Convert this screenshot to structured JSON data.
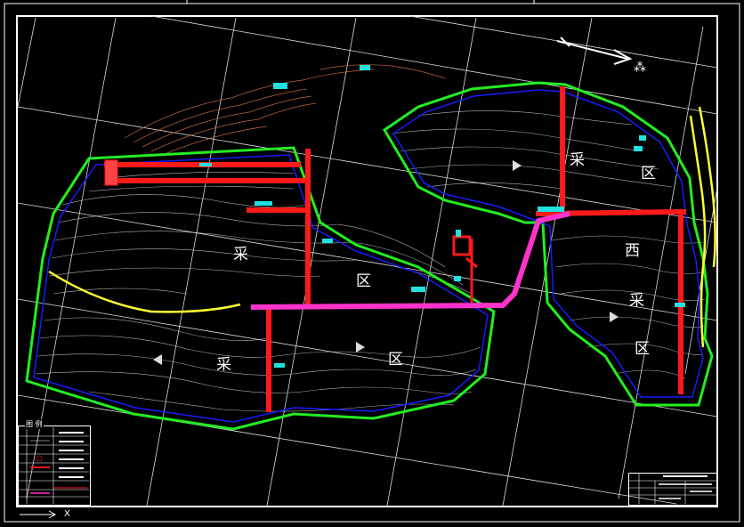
{
  "drawing": {
    "zone_labels": [
      {
        "id": "zone-north-cai",
        "text": "采"
      },
      {
        "id": "zone-north-qu",
        "text": "区"
      },
      {
        "id": "zone-south-cai",
        "text": "采"
      },
      {
        "id": "zone-south-qu",
        "text": "区"
      },
      {
        "id": "zone-west-xi",
        "text": "西"
      },
      {
        "id": "zone-west-cai",
        "text": "采"
      },
      {
        "id": "zone-west-qu",
        "text": "区"
      },
      {
        "id": "zone-east-cai",
        "text": "采"
      },
      {
        "id": "zone-east-qu",
        "text": "区"
      }
    ],
    "legend_title": "图 例",
    "compass_label": "X"
  },
  "colors": {
    "background": "#000000",
    "frame": "#ffffff",
    "boundary": "#22ee22",
    "inner_boundary": "#1a1aff",
    "roadway": "#ff1a1a",
    "main_haulage": "#ff33cc",
    "contour": "#d8d8d8",
    "grid": "#e0e0e0",
    "yellow_line": "#ffff33",
    "annotation": "#22e0e0",
    "topo": "#c0683c"
  }
}
